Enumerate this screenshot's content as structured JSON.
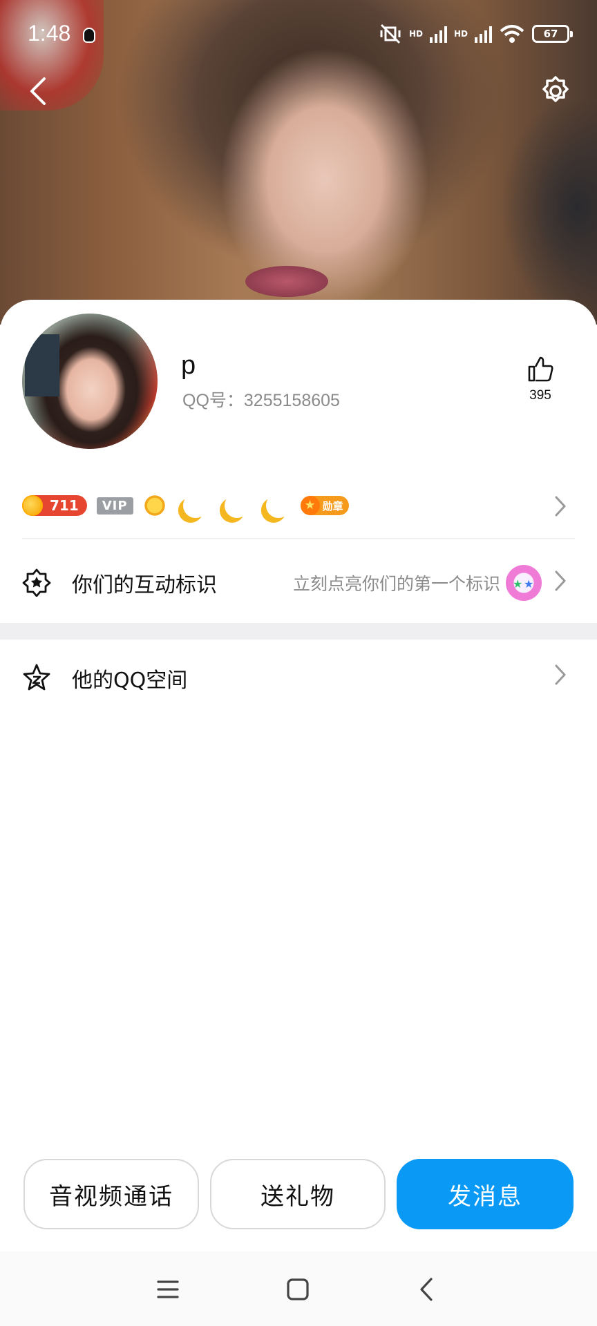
{
  "status_bar": {
    "time": "1:48",
    "battery": "67",
    "net_label_1": "HD",
    "net_label_2": "HD"
  },
  "profile": {
    "name": "p",
    "qq_number": "QQ号：3255158605",
    "likes": "395",
    "level": "711",
    "vip": "VIP",
    "medal": "勋章"
  },
  "rows": {
    "interaction_label": "你们的互动标识",
    "interaction_hint": "立刻点亮你们的第一个标识",
    "qzone_label": "他的QQ空间"
  },
  "actions": {
    "call": "音视频通话",
    "gift": "送礼物",
    "message": "发消息"
  },
  "colors": {
    "primary": "#0a9af5",
    "level_badge": "#e6462f",
    "gold": "#f5b71f"
  },
  "icons": [
    "back-icon",
    "settings-icon",
    "thumbs-up-icon",
    "interaction-star-icon",
    "qzone-star-icon",
    "chevron-right-icon",
    "menu-icon",
    "home-icon",
    "nav-back-icon"
  ]
}
